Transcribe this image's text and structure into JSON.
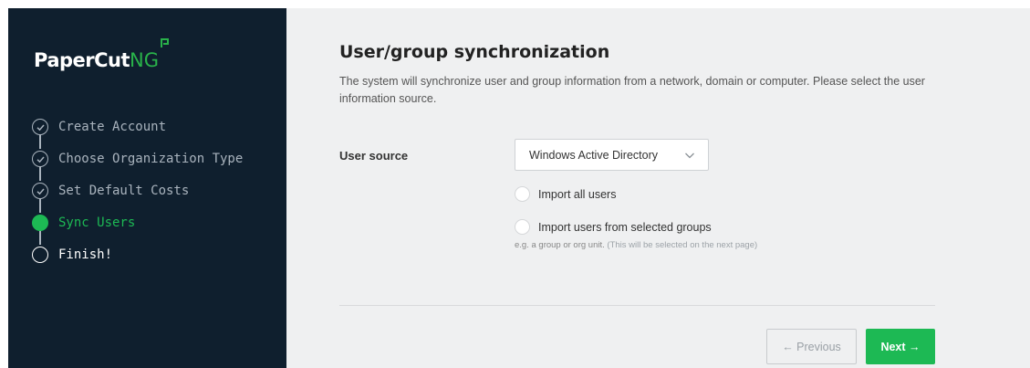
{
  "colors": {
    "sidebar_bg": "#0f1f2e",
    "accent": "#1db954",
    "main_bg": "#eff0f1"
  },
  "logo": {
    "text_main": "PaperCut",
    "text_suffix": "NG"
  },
  "steps": [
    {
      "label": "Create Account",
      "state": "done",
      "icon": "check-icon"
    },
    {
      "label": "Choose Organization Type",
      "state": "done",
      "icon": "check-icon"
    },
    {
      "label": "Set Default Costs",
      "state": "done",
      "icon": "check-icon"
    },
    {
      "label": "Sync Users",
      "state": "active",
      "icon": "filled-circle-icon"
    },
    {
      "label": "Finish!",
      "state": "pending",
      "icon": "empty-circle-icon"
    }
  ],
  "main": {
    "title": "User/group synchronization",
    "description": "The system will synchronize user and group information from a network, domain or computer. Please select the user information source.",
    "user_source_label": "User source",
    "user_source_value": "Windows Active Directory",
    "radio_all": "Import all users",
    "radio_groups": "Import users from selected groups",
    "hint_main": "e.g. a group or org unit.",
    "hint_soft": "(This will be selected on the next page)"
  },
  "buttons": {
    "previous": "← Previous",
    "next": "Next →"
  }
}
